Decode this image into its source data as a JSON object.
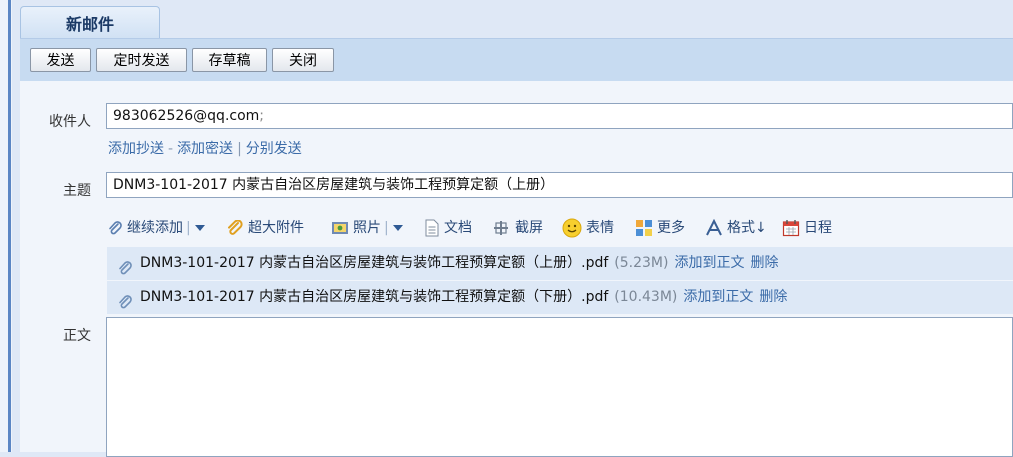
{
  "tab": {
    "title": "新邮件"
  },
  "toolbar": {
    "send": "发送",
    "scheduled_send": "定时发送",
    "save_draft": "存草稿",
    "close": "关闭"
  },
  "compose": {
    "recipient_label": "收件人",
    "recipient_value": "983062526@qq.com",
    "recipient_sep": ";",
    "add_cc": "添加抄送",
    "sep_dash": "-",
    "add_bcc": "添加密送",
    "sep_bar": "|",
    "send_separately": "分别发送",
    "subject_label": "主题",
    "subject_value": "DNM3-101-2017 内蒙古自治区房屋建筑与装饰工程预算定额（上册）",
    "body_label": "正文"
  },
  "attach_toolbar": {
    "continue_add": "继续添加",
    "large_attachment": "超大附件",
    "photo": "照片",
    "document": "文档",
    "screenshot": "截屏",
    "emoticon": "表情",
    "more": "更多",
    "format": "格式↓",
    "schedule": "日程"
  },
  "attachments": [
    {
      "name": "DNM3-101-2017 内蒙古自治区房屋建筑与装饰工程预算定额（上册）.pdf",
      "size": "(5.23M)",
      "add_to_body": "添加到正文",
      "delete": "删除"
    },
    {
      "name": "DNM3-101-2017 内蒙古自治区房屋建筑与装饰工程预算定额（下册）.pdf",
      "size": "(10.43M)",
      "add_to_body": "添加到正文",
      "delete": "删除"
    }
  ],
  "colors": {
    "accent": "#3b6ba8",
    "toolbar_bg": "#c7dbf1",
    "main_bg": "#f1f5fb",
    "attachment_row_bg": "#dde8f6"
  },
  "icons": [
    "paperclip-icon",
    "dropdown-arrow-icon",
    "large-attachment-icon",
    "photo-icon",
    "document-icon",
    "screenshot-icon",
    "smiley-icon",
    "more-grid-icon",
    "format-icon",
    "calendar-icon"
  ]
}
